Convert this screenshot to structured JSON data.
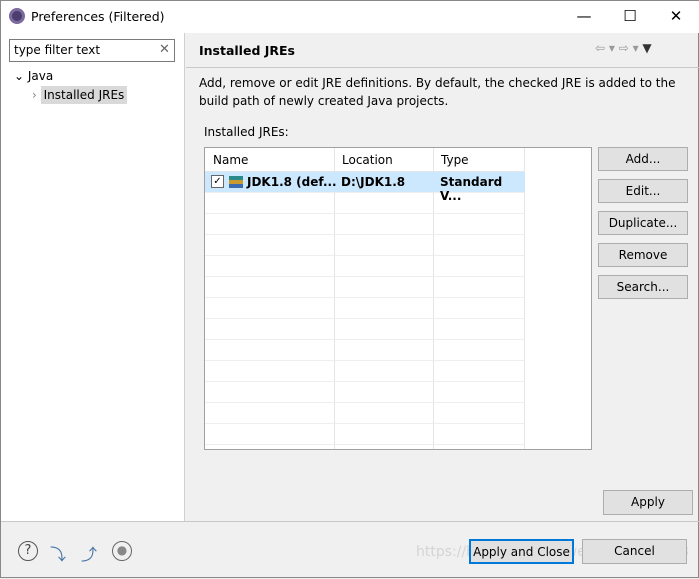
{
  "window": {
    "title": "Preferences (Filtered)",
    "minimize": "—",
    "maximize": "☐",
    "close": "✕"
  },
  "sidebar": {
    "filter_value": "type filter text",
    "clear_icon": "✕",
    "tree": [
      {
        "label": "Java",
        "expanded": true
      },
      {
        "label": "Installed JREs",
        "selected": true
      }
    ]
  },
  "page": {
    "title": "Installed JREs",
    "description": "Add, remove or edit JRE definitions. By default, the checked JRE is added to the build path of newly created Java projects.",
    "list_label": "Installed JREs:"
  },
  "table": {
    "columns": [
      "Name",
      "Location",
      "Type"
    ],
    "rows": [
      {
        "checked": true,
        "name": "JDK1.8 (def...",
        "location": "D:\\JDK1.8",
        "type": "Standard V..."
      }
    ]
  },
  "buttons": {
    "add": "Add...",
    "edit": "Edit...",
    "duplicate": "Duplicate...",
    "remove": "Remove",
    "search": "Search...",
    "apply": "Apply",
    "apply_close": "Apply and Close",
    "cancel": "Cancel"
  },
  "footer_icons": [
    "help-icon",
    "import-icon",
    "export-icon",
    "record-icon"
  ],
  "watermark": "https://blog.csdn.net/weixin_42594143"
}
